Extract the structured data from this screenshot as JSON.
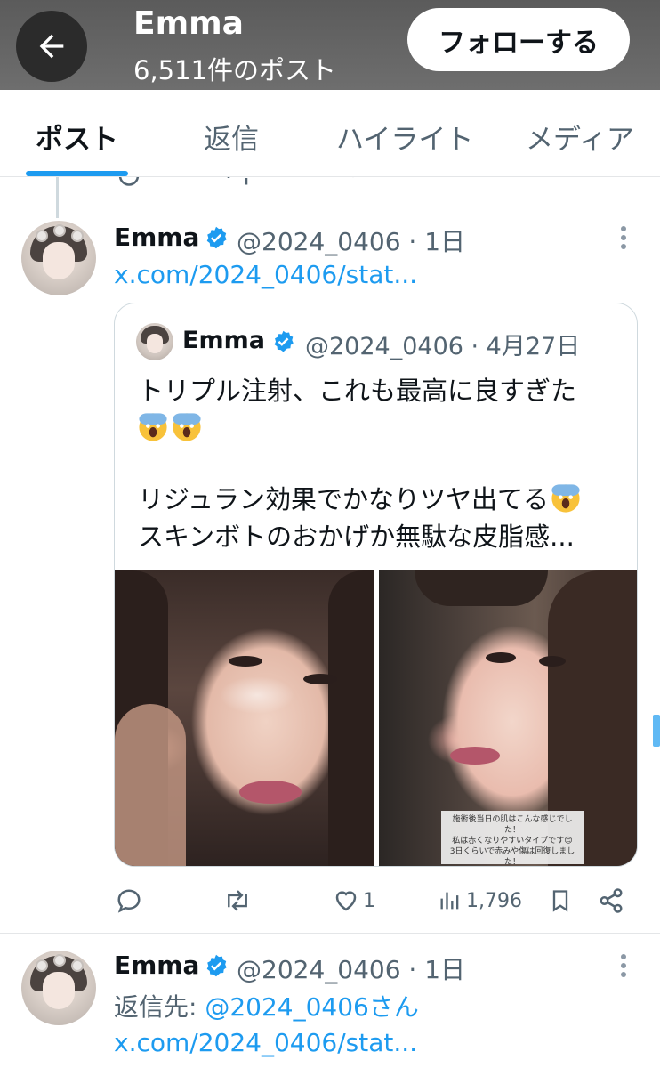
{
  "header": {
    "title": "Emma",
    "subtitle": "6,511件のポスト",
    "follow_label": "フォローする"
  },
  "tabs": [
    {
      "label": "ポスト",
      "active": true
    },
    {
      "label": "返信",
      "active": false
    },
    {
      "label": "ハイライト",
      "active": false
    },
    {
      "label": "メディア",
      "active": false
    }
  ],
  "post1": {
    "author": "Emma",
    "handle_time": "@2024_0406 · 1日",
    "link": "x.com/2024_0406/stat...",
    "quote": {
      "author": "Emma",
      "handle_time": "@2024_0406 · 4月27日",
      "line1": "トリプル注射、これも最高に良すぎた",
      "line2": "リジュラン効果でかなりツヤ出てる",
      "line3": "スキンボトのおかげか無駄な皮脂感...",
      "photo_caption": "施術後当日の肌はこんな感じでした！\n私は赤くなりやすいタイプです😊\n3日くらいで赤みや傷は回復しました！\n※額には施術していません"
    },
    "actions": {
      "reply_count": "",
      "repost_count": "",
      "like_count": "1",
      "view_count": "1,796"
    }
  },
  "post2": {
    "author": "Emma",
    "handle_time": "@2024_0406 · 1日",
    "reply_prefix": "返信先: ",
    "reply_to": "@2024_0406さん",
    "link": "x.com/2024_0406/stat..."
  },
  "colors": {
    "accent": "#1d9bf0",
    "verified": "#1d9bf0",
    "muted": "#536471"
  }
}
